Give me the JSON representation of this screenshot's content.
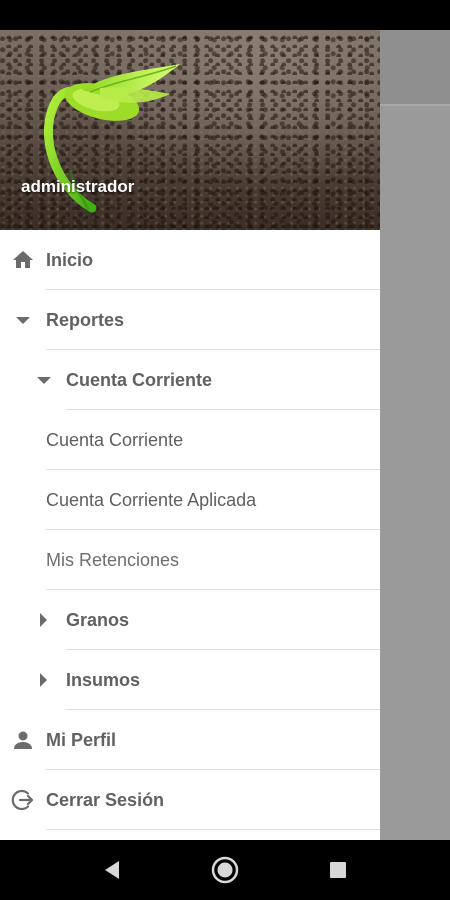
{
  "header": {
    "user_name": "administrador"
  },
  "menu": {
    "items": [
      {
        "label": "Inicio",
        "icon": "home-icon"
      },
      {
        "label": "Reportes",
        "icon": "caret-down-icon",
        "expanded": true
      },
      {
        "label": "Cuenta Corriente",
        "icon": "caret-down-icon",
        "expanded": true
      },
      {
        "label": "Cuenta Corriente"
      },
      {
        "label": "Cuenta Corriente Aplicada"
      },
      {
        "label": "Mis Retenciones"
      },
      {
        "label": "Granos",
        "icon": "caret-right-icon",
        "expanded": false
      },
      {
        "label": "Insumos",
        "icon": "caret-right-icon",
        "expanded": false
      },
      {
        "label": "Mi Perfil",
        "icon": "person-icon"
      },
      {
        "label": "Cerrar Sesión",
        "icon": "logout-icon"
      }
    ]
  },
  "navigation": {
    "buttons": [
      "back-icon",
      "home-circle-icon",
      "recents-icon"
    ]
  },
  "colors": {
    "drawer_background": "#ffffff",
    "text": "#616161",
    "scrim": "#9e9e9e"
  }
}
